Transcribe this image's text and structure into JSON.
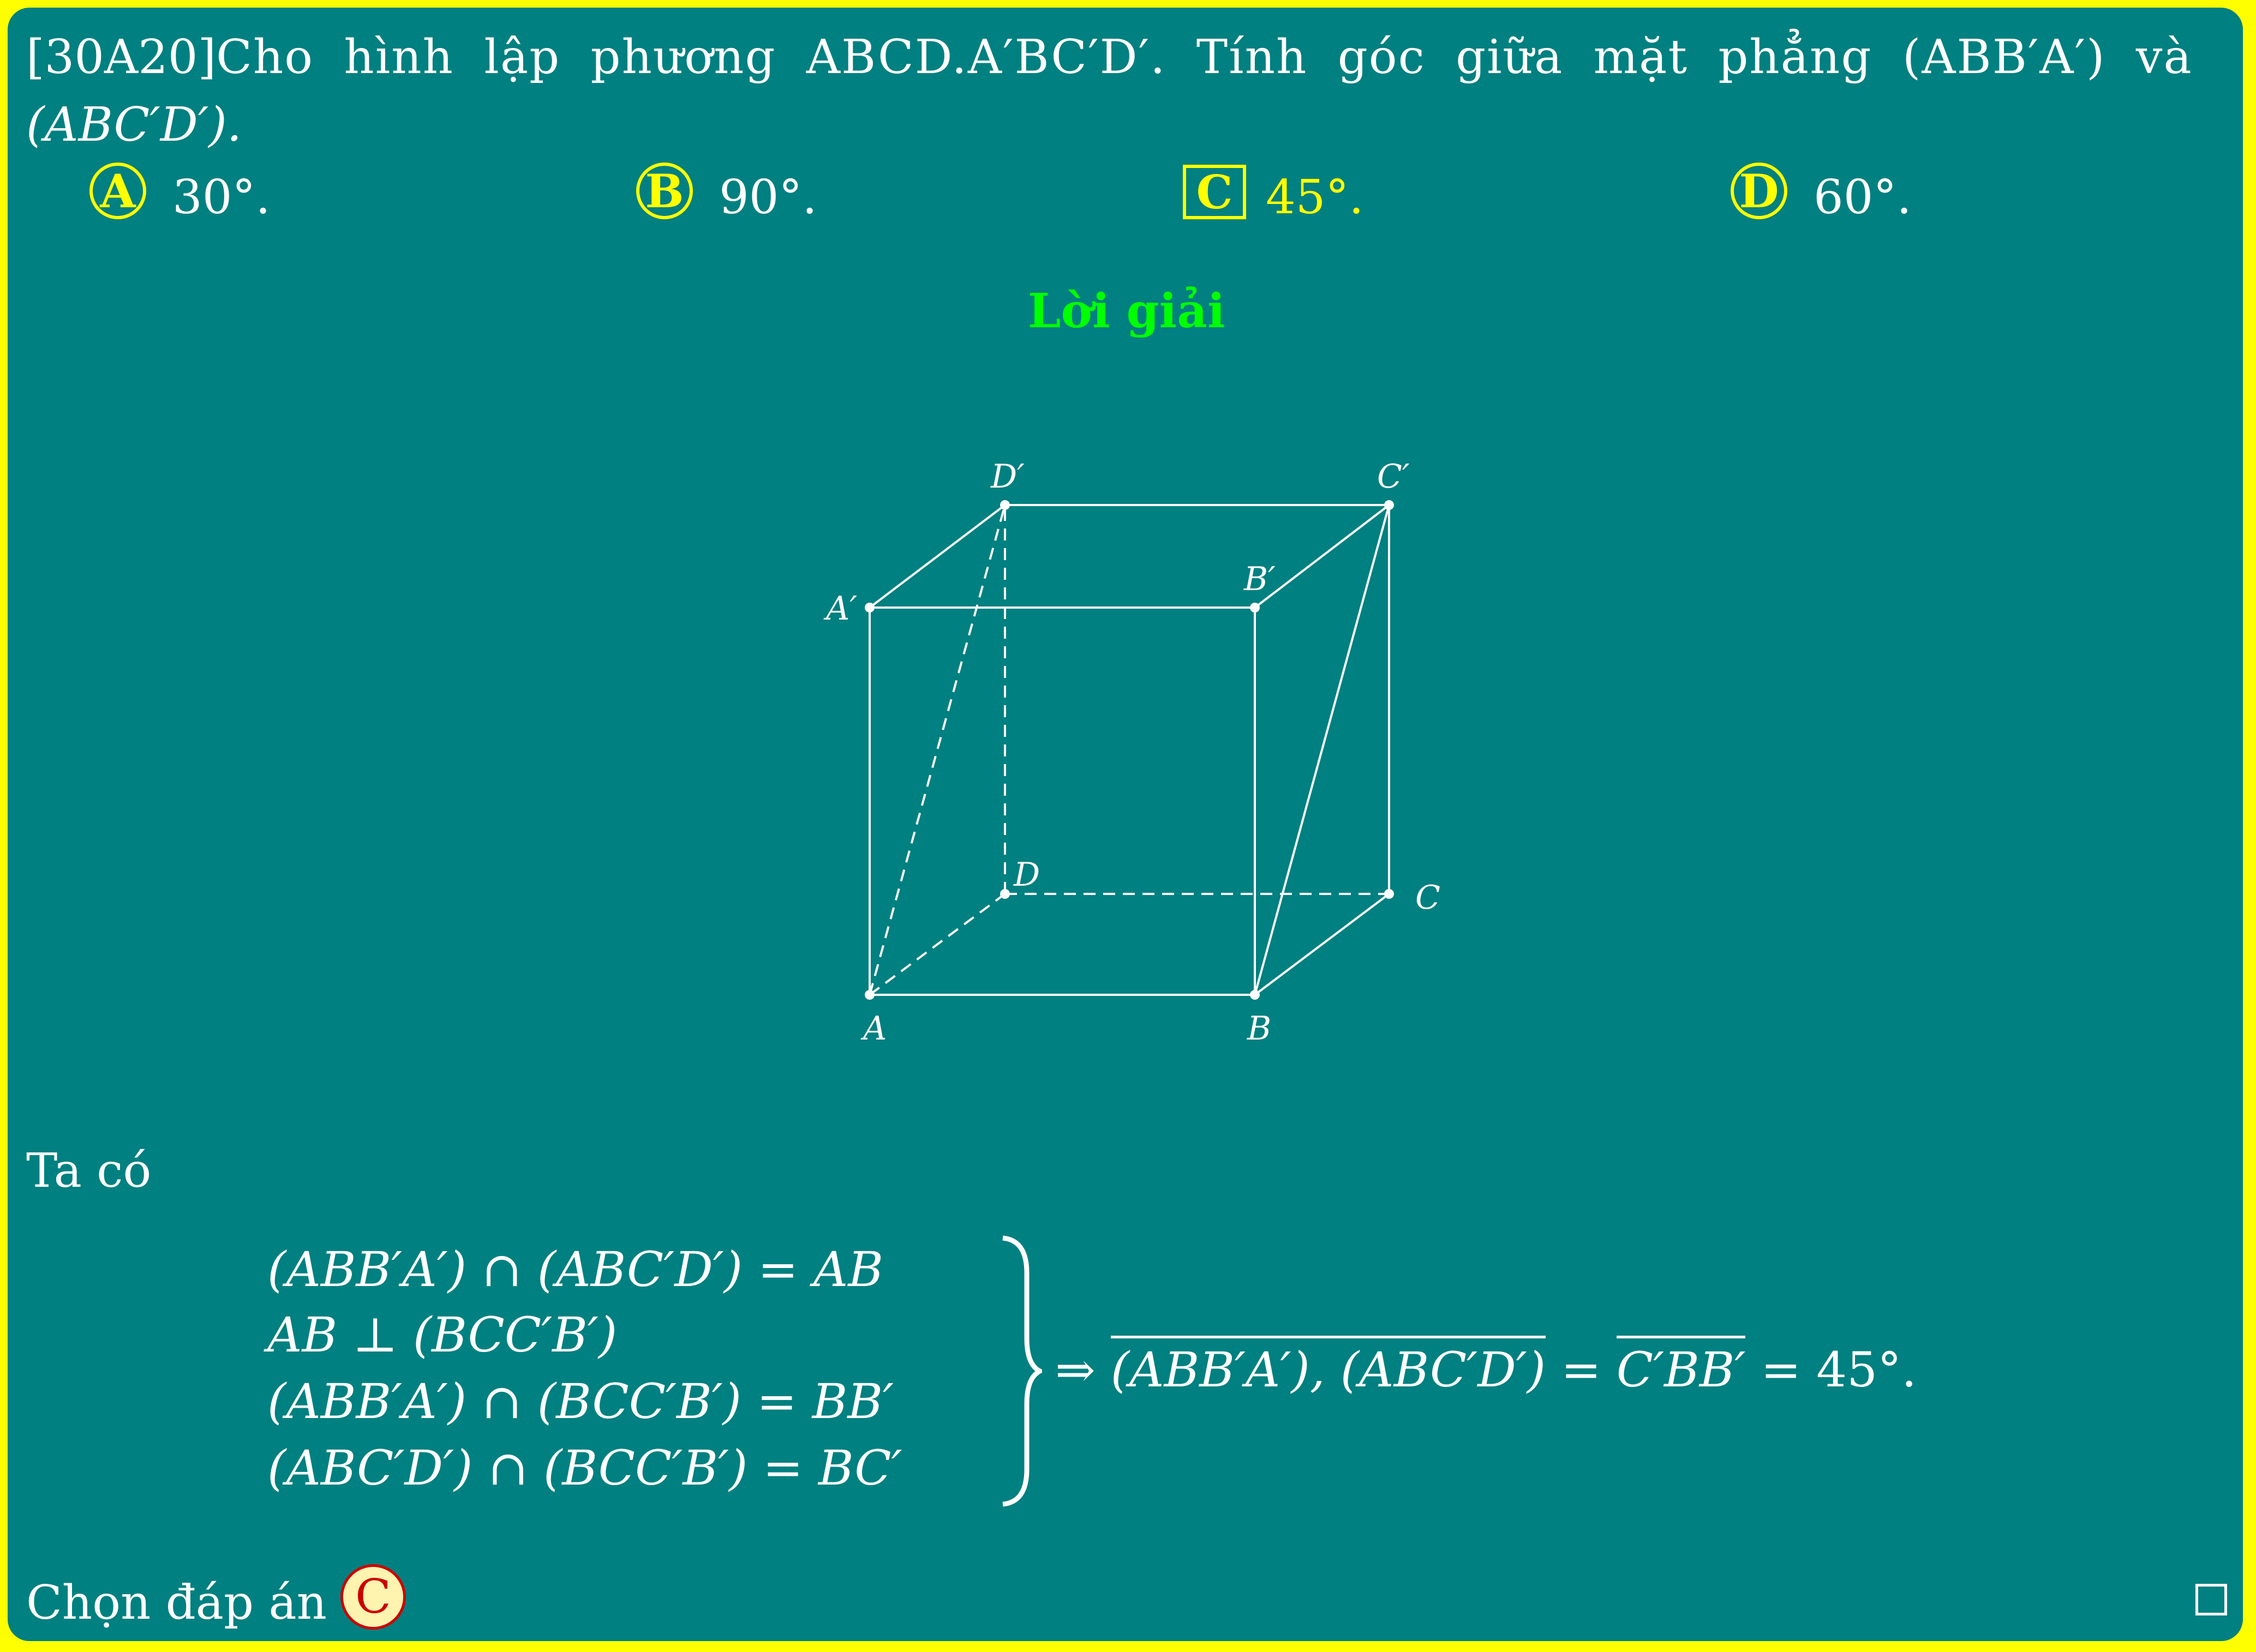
{
  "question": {
    "tag": "[30A20]",
    "text": "Cho hình lập phương ABCD.A′BC′D′. Tính góc giữa mặt phẳng (ABB′A′) và",
    "text_line2": "(ABC′D′)."
  },
  "options": [
    {
      "letter": "A",
      "value": "30°."
    },
    {
      "letter": "B",
      "value": "90°."
    },
    {
      "letter": "C",
      "value": "45°."
    },
    {
      "letter": "D",
      "value": "60°."
    }
  ],
  "correct_option": "C",
  "solution_title": "Lời giải",
  "figure": {
    "labels": {
      "A": "A",
      "B": "B",
      "C": "C",
      "D": "D",
      "A1": "A′",
      "B1": "B′",
      "C1": "C′",
      "D1": "D′"
    }
  },
  "solution": {
    "intro": "Ta có",
    "system": [
      "(ABB′A′) ∩ (ABC′D′) = AB",
      "AB ⊥ (BCC′B′)",
      "(ABB′A′) ∩ (BCC′B′) = BB′",
      "(ABC′D′) ∩ (BCC′B′) = BC′"
    ],
    "conclusion_prefix": "⇒ ",
    "conclusion_angle": "(ABB′A′), (ABC′D′)",
    "conclusion_mid": " = ",
    "conclusion_angle2": "C′BB′",
    "conclusion_suffix": " = 45°.",
    "final_text": "Chọn đáp án",
    "final_answer": "C"
  },
  "colors": {
    "background": "#008080",
    "frame": "#ffff00",
    "option_accent": "#ffff00",
    "title": "#00ff00",
    "text": "#ffffff",
    "answer_badge_fill": "#fff3b0",
    "answer_badge_text": "#cc0000"
  }
}
